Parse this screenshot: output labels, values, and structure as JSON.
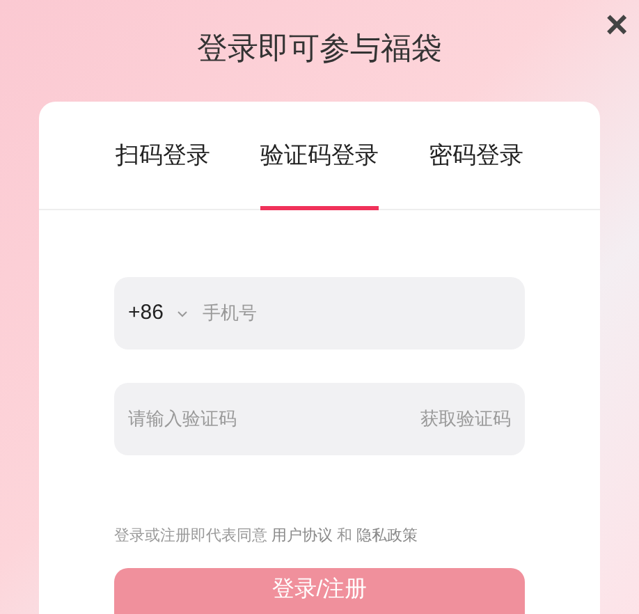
{
  "dialog": {
    "title": "登录即可参与福袋",
    "close": "×"
  },
  "tabs": [
    {
      "label": "扫码登录",
      "selected": false
    },
    {
      "label": "验证码登录",
      "selected": true
    },
    {
      "label": "密码登录",
      "selected": false
    }
  ],
  "phone": {
    "country_code": "+86",
    "placeholder": "手机号"
  },
  "code": {
    "placeholder": "请输入验证码",
    "action": "获取验证码"
  },
  "agreement": [
    {
      "kind": "text",
      "text": "登录或注册即代表同意"
    },
    {
      "kind": "link",
      "text": "用户协议"
    },
    {
      "kind": "text",
      "text": "和"
    },
    {
      "kind": "link",
      "text": "隐私政策"
    }
  ],
  "submit": "登录/注册"
}
